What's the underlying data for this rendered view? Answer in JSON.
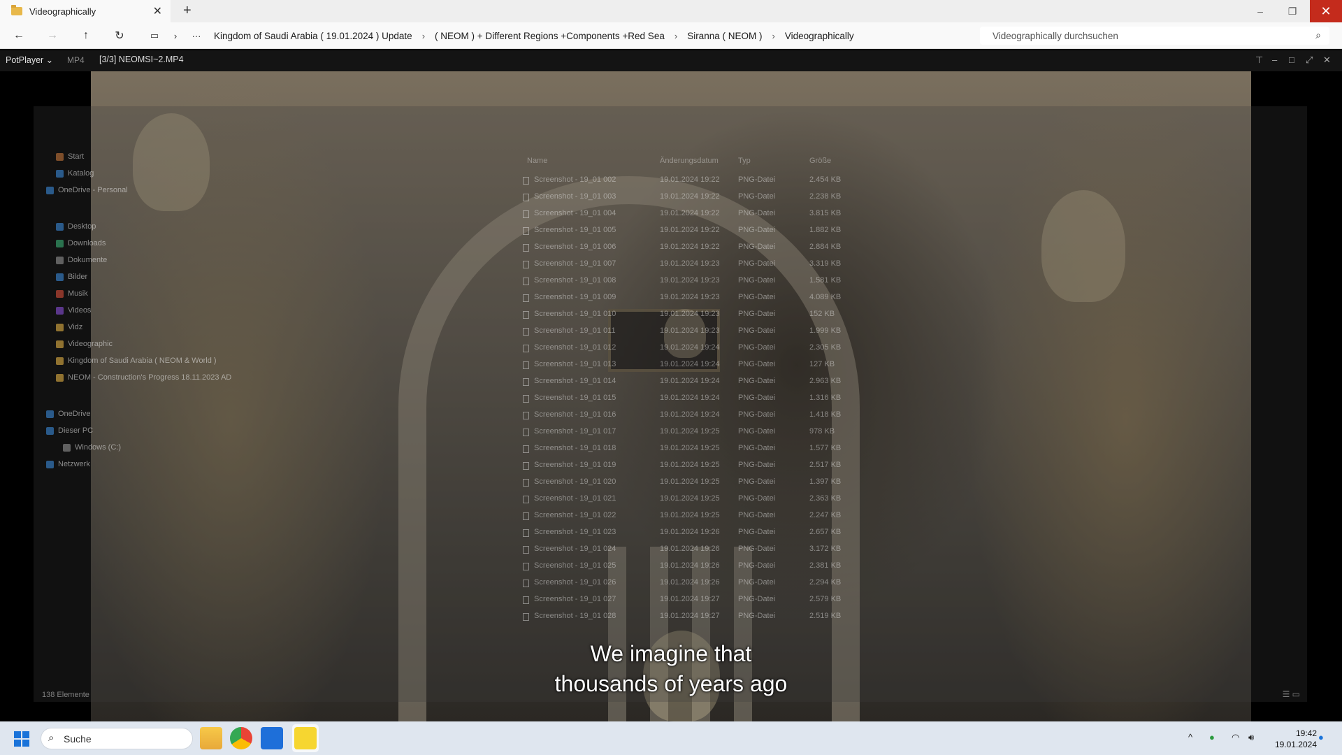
{
  "explorer": {
    "tab_title": "Videographically",
    "tab_close": "✕",
    "new_tab": "+",
    "window_controls": {
      "minimize": "–",
      "maximize": "❐",
      "close": "✕"
    },
    "nav": {
      "back": "←",
      "forward": "→",
      "up": "↑",
      "refresh": "↻",
      "more": "···"
    },
    "breadcrumbs": [
      "Kingdom of Saudi Arabia ( 19.01.2024 ) Update",
      "( NEOM ) + Different Regions +Components +Red Sea",
      "Siranna ( NEOM )",
      "Videographically"
    ],
    "search_placeholder": "Videographically durchsuchen"
  },
  "player": {
    "brand": "PotPlayer ⌄",
    "format": "MP4",
    "file": "[3/3] NEOMSI~2.MP4",
    "controls": {
      "pin": "⊤",
      "minimize": "–",
      "maximize": "□",
      "fullscreen": "⤢",
      "close": "✕"
    },
    "subtitle_line1": "We imagine that",
    "subtitle_line2": "thousands of years ago"
  },
  "ghost_explorer": {
    "sidebar": [
      "Start",
      "Katalog",
      "OneDrive - Personal",
      "Desktop",
      "Downloads",
      "Dokumente",
      "Bilder",
      "Musik",
      "Videos",
      "Vidz",
      "Videographic",
      "Kingdom of Saudi Arabia ( NEOM & World )",
      "NEOM - Construction's Progress 18.11.2023 AD",
      "OneDrive",
      "Dieser PC",
      "Windows (C:)",
      "Netzwerk"
    ],
    "columns": {
      "name": "Name",
      "date": "Änderungsdatum",
      "type": "Typ",
      "size": "Größe"
    },
    "files": [
      {
        "name": "Screenshot - 19_01 002",
        "date": "19.01.2024 19:22",
        "type": "PNG-Datei",
        "size": "2.454 KB"
      },
      {
        "name": "Screenshot - 19_01 003",
        "date": "19.01.2024 19:22",
        "type": "PNG-Datei",
        "size": "2.238 KB"
      },
      {
        "name": "Screenshot - 19_01 004",
        "date": "19.01.2024 19:22",
        "type": "PNG-Datei",
        "size": "3.815 KB"
      },
      {
        "name": "Screenshot - 19_01 005",
        "date": "19.01.2024 19:22",
        "type": "PNG-Datei",
        "size": "1.882 KB"
      },
      {
        "name": "Screenshot - 19_01 006",
        "date": "19.01.2024 19:22",
        "type": "PNG-Datei",
        "size": "2.884 KB"
      },
      {
        "name": "Screenshot - 19_01 007",
        "date": "19.01.2024 19:23",
        "type": "PNG-Datei",
        "size": "3.319 KB"
      },
      {
        "name": "Screenshot - 19_01 008",
        "date": "19.01.2024 19:23",
        "type": "PNG-Datei",
        "size": "1.581 KB"
      },
      {
        "name": "Screenshot - 19_01 009",
        "date": "19.01.2024 19:23",
        "type": "PNG-Datei",
        "size": "4.089 KB"
      },
      {
        "name": "Screenshot - 19_01 010",
        "date": "19.01.2024 19:23",
        "type": "PNG-Datei",
        "size": "152 KB"
      },
      {
        "name": "Screenshot - 19_01 011",
        "date": "19.01.2024 19:23",
        "type": "PNG-Datei",
        "size": "1.999 KB"
      },
      {
        "name": "Screenshot - 19_01 012",
        "date": "19.01.2024 19:24",
        "type": "PNG-Datei",
        "size": "2.305 KB"
      },
      {
        "name": "Screenshot - 19_01 013",
        "date": "19.01.2024 19:24",
        "type": "PNG-Datei",
        "size": "127 KB"
      },
      {
        "name": "Screenshot - 19_01 014",
        "date": "19.01.2024 19:24",
        "type": "PNG-Datei",
        "size": "2.963 KB"
      },
      {
        "name": "Screenshot - 19_01 015",
        "date": "19.01.2024 19:24",
        "type": "PNG-Datei",
        "size": "1.316 KB"
      },
      {
        "name": "Screenshot - 19_01 016",
        "date": "19.01.2024 19:24",
        "type": "PNG-Datei",
        "size": "1.418 KB"
      },
      {
        "name": "Screenshot - 19_01 017",
        "date": "19.01.2024 19:25",
        "type": "PNG-Datei",
        "size": "978 KB"
      },
      {
        "name": "Screenshot - 19_01 018",
        "date": "19.01.2024 19:25",
        "type": "PNG-Datei",
        "size": "1.577 KB"
      },
      {
        "name": "Screenshot - 19_01 019",
        "date": "19.01.2024 19:25",
        "type": "PNG-Datei",
        "size": "2.517 KB"
      },
      {
        "name": "Screenshot - 19_01 020",
        "date": "19.01.2024 19:25",
        "type": "PNG-Datei",
        "size": "1.397 KB"
      },
      {
        "name": "Screenshot - 19_01 021",
        "date": "19.01.2024 19:25",
        "type": "PNG-Datei",
        "size": "2.363 KB"
      },
      {
        "name": "Screenshot - 19_01 022",
        "date": "19.01.2024 19:25",
        "type": "PNG-Datei",
        "size": "2.247 KB"
      },
      {
        "name": "Screenshot - 19_01 023",
        "date": "19.01.2024 19:26",
        "type": "PNG-Datei",
        "size": "2.657 KB"
      },
      {
        "name": "Screenshot - 19_01 024",
        "date": "19.01.2024 19:26",
        "type": "PNG-Datei",
        "size": "3.172 KB"
      },
      {
        "name": "Screenshot - 19_01 025",
        "date": "19.01.2024 19:26",
        "type": "PNG-Datei",
        "size": "2.381 KB"
      },
      {
        "name": "Screenshot - 19_01 026",
        "date": "19.01.2024 19:26",
        "type": "PNG-Datei",
        "size": "2.294 KB"
      },
      {
        "name": "Screenshot - 19_01 027",
        "date": "19.01.2024 19:27",
        "type": "PNG-Datei",
        "size": "2.579 KB"
      },
      {
        "name": "Screenshot - 19_01 028",
        "date": "19.01.2024 19:27",
        "type": "PNG-Datei",
        "size": "2.519 KB"
      }
    ],
    "item_count": "138 Elemente"
  },
  "taskbar": {
    "search_placeholder": "Suche",
    "time": "19:42",
    "date": "19.01.2024",
    "tray_chevron": "^",
    "wifi": "◠",
    "volume": "🔊︎",
    "notification": "●",
    "apps": [
      "file-explorer",
      "chrome",
      "microsoft-store",
      "potplayer"
    ]
  },
  "colors": {
    "accent_blue": "#1a73d9",
    "close_red": "#c42b1c",
    "taskbar": "#dfe6ef",
    "player_bar": "#141414"
  }
}
